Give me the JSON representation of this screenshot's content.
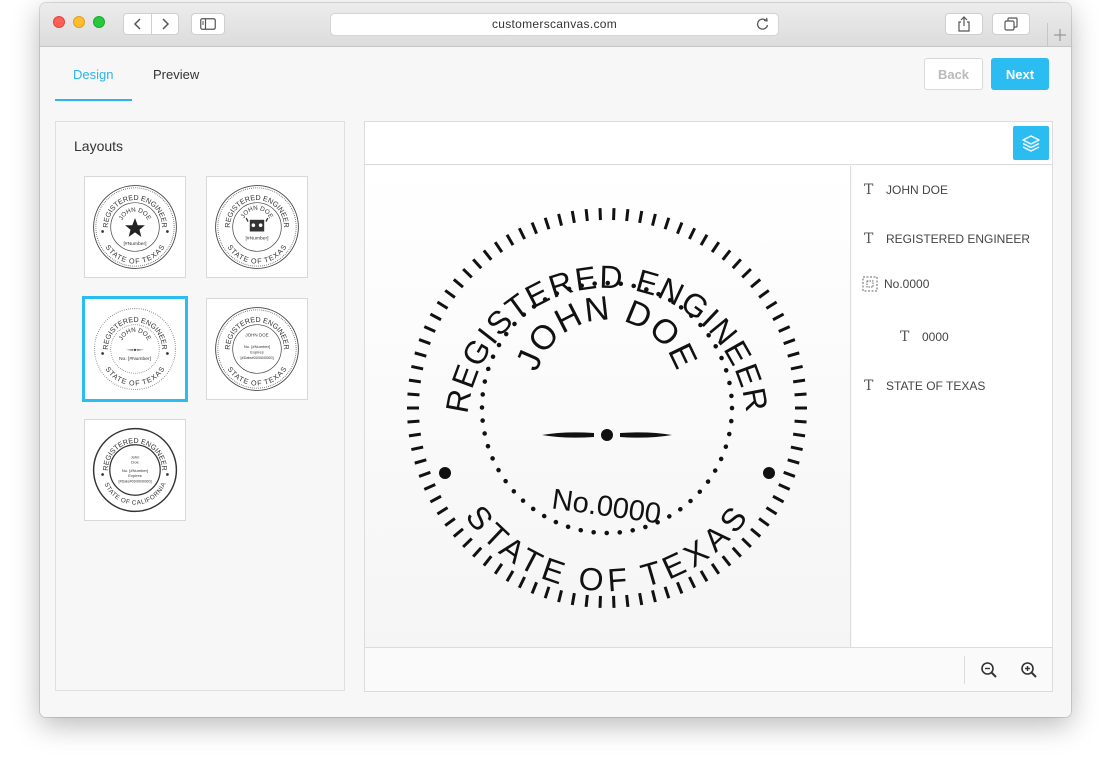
{
  "browser": {
    "url": "customerscanvas.com"
  },
  "tabs": {
    "design": "Design",
    "preview": "Preview"
  },
  "actions": {
    "back": "Back",
    "next": "Next"
  },
  "layouts": {
    "title": "Layouts",
    "items": [
      {
        "top": "REGISTERED ENGINEER",
        "name": "JOHN DOE",
        "number": "[#Number]",
        "bottom": "STATE OF TEXAS"
      },
      {
        "top": "REGISTERED ENGINEER",
        "name": "JOHN DOE",
        "number": "[#Number]",
        "bottom": "STATE OF TEXAS"
      },
      {
        "top": "REGISTERED ENGINEER",
        "name": "JOHN DOE",
        "number": "No. [#Number]",
        "bottom": "STATE OF TEXAS"
      },
      {
        "top": "REGISTERED ENGINEER",
        "name": "JOHN DOE",
        "number": "No. [#Number]",
        "extra": "Expires",
        "date": "[#Date#00/00/0000]",
        "bottom": "STATE OF TEXAS"
      },
      {
        "top": "REGISTERED ENGINEER",
        "name1": "John",
        "name2": "Doe",
        "number": "No. [#Number]",
        "extra": "Expires",
        "date": "[#Date#00/00/0000]",
        "bottom": "STATE OF CALIFORNIA"
      }
    ],
    "selected_index": 2
  },
  "seal": {
    "top_text": "REGISTERED ENGINEER",
    "name": "JOHN DOE",
    "number": "No.0000",
    "bottom_text": "STATE OF TEXAS"
  },
  "layers": [
    {
      "icon": "text-icon",
      "label": "JOHN DOE"
    },
    {
      "icon": "text-icon",
      "label": "REGISTERED ENGINEER"
    },
    {
      "icon": "group-icon",
      "label": "No.0000"
    },
    {
      "icon": "text-icon",
      "label": "0000"
    },
    {
      "icon": "text-icon",
      "label": "STATE OF TEXAS"
    }
  ],
  "colors": {
    "accent": "#2bbcf2",
    "tab_active": "#2bb5ec"
  }
}
